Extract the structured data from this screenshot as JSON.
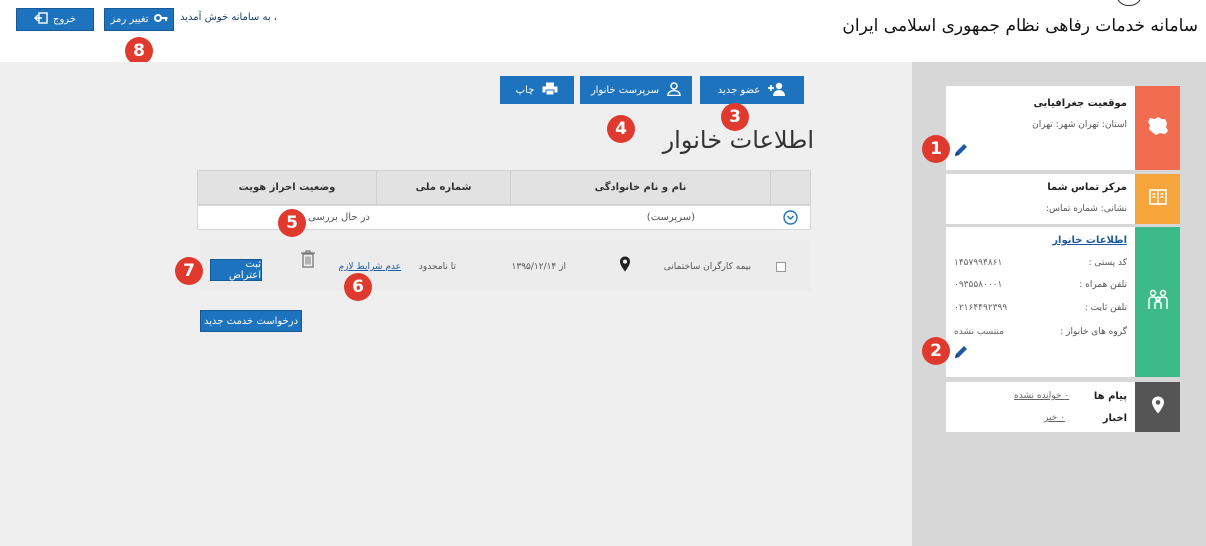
{
  "header": {
    "brand_title": "سامانه خدمات رفاهی نظام جمهوری اسلامی ایران",
    "welcome_text": "، به سامانه خوش آمدید",
    "change_password_label": "تغییر رمز",
    "logout_label": "خروج"
  },
  "toolbar": {
    "new_member_label": "عضو جدید",
    "family_head_label": "سرپرست خانوار",
    "print_label": "چاپ"
  },
  "page": {
    "title": "اطلاعات خانوار"
  },
  "table": {
    "columns": [
      "نام و نام خانوادگی",
      "شماره ملی",
      "وضعیت احراز هویت"
    ],
    "rows": [
      {
        "name": "(سرپرست)",
        "national_id": "",
        "auth_status": "در حال بررسی"
      }
    ],
    "service_row": {
      "service_name": "بیمه کارگران ساختمانی",
      "from_label": "از ۱۳۹۵/۱۲/۱۴",
      "to_label": "تا نامحدود",
      "conditions_link": "عدم شرایط لازم",
      "objection_label": "ثبت اعتراض"
    },
    "new_service_label": "درخواست خدمت جدید"
  },
  "sidebar": {
    "geo": {
      "title": "موقعیت جغرافیایی",
      "value": "استان: تهران شهر: تهران"
    },
    "contact": {
      "title": "مرکز تماس شما",
      "value": "نشانی: شماره تماس:"
    },
    "family": {
      "title": "اطلاعات خانوار",
      "postal_label": "کد پستی :",
      "postal_value": "۱۴۵۷۹۹۴۸۶۱",
      "mobile_label": "تلفن همراه :",
      "mobile_value": "۰۹۳۵۵۸۰۰۰۱",
      "phone_label": "تلفن ثابت :",
      "phone_value": "۰۲۱۶۴۴۹۲۳۹۹",
      "groups_label": "گروه های خانوار :",
      "groups_value": "منتسب نشده"
    },
    "messages": {
      "messages_label": "پیام ها",
      "messages_value": "۰ خوانده نشده",
      "news_label": "اخبار",
      "news_value": "۰ خبر"
    }
  },
  "callouts": {
    "one": "1",
    "two": "2",
    "three": "3",
    "four": "4",
    "five": "5",
    "six": "6",
    "seven": "7",
    "eight": "8"
  },
  "colors": {
    "accent_blue": "#1e73be",
    "geo_strip": "#f26d50",
    "contact_strip": "#f6a53a",
    "family_strip": "#3dba89",
    "messages_strip": "#555555",
    "badge_red": "#e03a2f"
  },
  "icons": {
    "add_user": "add-user-icon",
    "person": "person-icon",
    "printer": "printer-icon",
    "key": "key-icon",
    "logout": "logout-icon",
    "expand": "expand-circle-icon",
    "location_pin": "location-pin-icon",
    "trash": "trash-icon",
    "pencil": "pencil-icon",
    "map": "iran-map-icon",
    "book": "book-icon",
    "family": "family-icon"
  }
}
